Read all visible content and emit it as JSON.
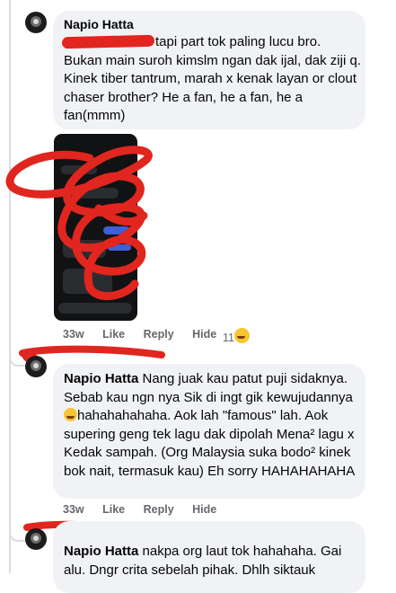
{
  "comments": [
    {
      "author": "Napio Hatta",
      "text": "tapi part tok paling lucu bro. Bukan main suroh kimslm ngan dak ijal, dak ziji q. Kinek tiber tantrum, marah x kenak layan or clout chaser brother? He a fan, he a fan, he a fan(mmm)",
      "time": "33w",
      "like": "Like",
      "reply": "Reply",
      "hide": "Hide",
      "reaction_count": "11"
    },
    {
      "author": "Napio Hatta",
      "text_a": "Nang juak kau patut puji sidaknya. Sebab kau ngn nya Sik di ingt gik kewujudannya",
      "text_b": "hahahahahaha. Aok lah \"famous\" lah. Aok supering geng tek lagu dak dipolah Mena² lagu x Kedak sampah. (Org Malaysia suka bodo² kinek bok nait, termasuk kau) Eh sorry HAHAHAHAHA",
      "time": "33w",
      "like": "Like",
      "reply": "Reply",
      "hide": "Hide"
    },
    {
      "author": "Napio Hatta",
      "text": "nakpa org laut tok hahahaha. Gai alu. Dngr crita sebelah pihak. Dhlh siktauk",
      "time": "",
      "like": "",
      "reply": "",
      "hide": ""
    }
  ],
  "icons": {
    "reaction": "laughing-face-icon",
    "inline_emoji": "rolling-laughing-face-icon"
  },
  "colors": {
    "bubble": "#f0f2f5",
    "meta": "#65676b",
    "scribble": "#e0261e"
  }
}
